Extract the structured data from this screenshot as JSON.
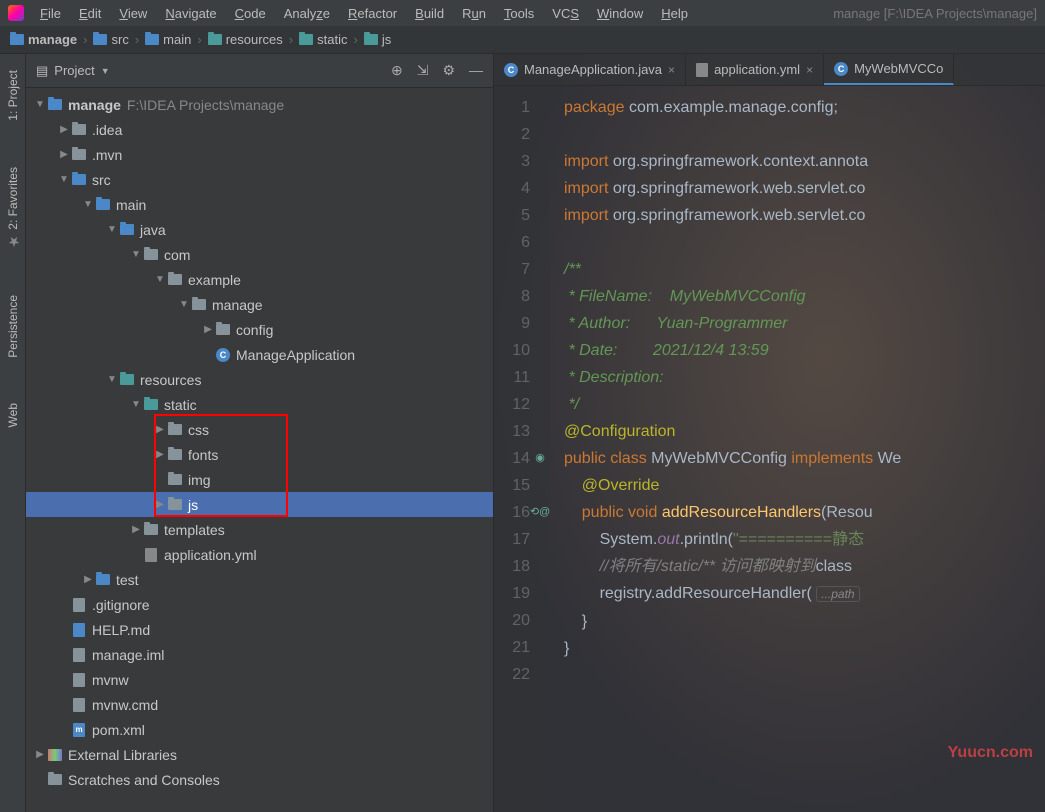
{
  "menubar": {
    "items": [
      "File",
      "Edit",
      "View",
      "Navigate",
      "Code",
      "Analyze",
      "Refactor",
      "Build",
      "Run",
      "Tools",
      "VCS",
      "Window",
      "Help"
    ],
    "title": "manage [F:\\IDEA Projects\\manage]"
  },
  "breadcrumb": [
    {
      "icon": "folder-blue",
      "label": "manage"
    },
    {
      "icon": "folder-blue",
      "label": "src"
    },
    {
      "icon": "folder-blue",
      "label": "main"
    },
    {
      "icon": "folder-teal",
      "label": "resources"
    },
    {
      "icon": "folder-teal",
      "label": "static"
    },
    {
      "icon": "folder-teal",
      "label": "js"
    }
  ],
  "sidebar_tabs": [
    "1: Project",
    "2: Favorites",
    "Persistence",
    "Web"
  ],
  "project_panel": {
    "title": "Project"
  },
  "tree": [
    {
      "d": 0,
      "a": "open",
      "i": "folder-blue",
      "l": "manage",
      "p": "F:\\IDEA Projects\\manage"
    },
    {
      "d": 1,
      "a": "closed",
      "i": "folder",
      "l": ".idea"
    },
    {
      "d": 1,
      "a": "closed",
      "i": "folder",
      "l": ".mvn"
    },
    {
      "d": 1,
      "a": "open",
      "i": "folder-blue",
      "l": "src"
    },
    {
      "d": 2,
      "a": "open",
      "i": "folder-blue",
      "l": "main"
    },
    {
      "d": 3,
      "a": "open",
      "i": "folder-blue",
      "l": "java"
    },
    {
      "d": 4,
      "a": "open",
      "i": "folder",
      "l": "com"
    },
    {
      "d": 5,
      "a": "open",
      "i": "folder",
      "l": "example"
    },
    {
      "d": 6,
      "a": "open",
      "i": "folder",
      "l": "manage"
    },
    {
      "d": 7,
      "a": "closed",
      "i": "folder",
      "l": "config"
    },
    {
      "d": 7,
      "a": "none",
      "i": "class",
      "l": "ManageApplication"
    },
    {
      "d": 3,
      "a": "open",
      "i": "folder-teal",
      "l": "resources"
    },
    {
      "d": 4,
      "a": "open",
      "i": "folder-teal",
      "l": "static"
    },
    {
      "d": 5,
      "a": "closed",
      "i": "folder",
      "l": "css"
    },
    {
      "d": 5,
      "a": "closed",
      "i": "folder",
      "l": "fonts"
    },
    {
      "d": 5,
      "a": "none",
      "i": "folder",
      "l": "img"
    },
    {
      "d": 5,
      "a": "closed",
      "i": "folder",
      "l": "js",
      "sel": true
    },
    {
      "d": 4,
      "a": "closed",
      "i": "folder",
      "l": "templates"
    },
    {
      "d": 4,
      "a": "none",
      "i": "yml",
      "l": "application.yml"
    },
    {
      "d": 2,
      "a": "closed",
      "i": "folder-blue",
      "l": "test"
    },
    {
      "d": 1,
      "a": "none",
      "i": "file",
      "l": ".gitignore"
    },
    {
      "d": 1,
      "a": "none",
      "i": "md",
      "l": "HELP.md"
    },
    {
      "d": 1,
      "a": "none",
      "i": "file",
      "l": "manage.iml"
    },
    {
      "d": 1,
      "a": "none",
      "i": "file",
      "l": "mvnw"
    },
    {
      "d": 1,
      "a": "none",
      "i": "file",
      "l": "mvnw.cmd"
    },
    {
      "d": 1,
      "a": "none",
      "i": "pom",
      "l": "pom.xml"
    },
    {
      "d": 0,
      "a": "closed",
      "i": "lib",
      "l": "External Libraries"
    },
    {
      "d": 0,
      "a": "none",
      "i": "scratch",
      "l": "Scratches and Consoles"
    }
  ],
  "editor_tabs": [
    {
      "icon": "class",
      "label": "ManageApplication.java",
      "close": true
    },
    {
      "icon": "yml",
      "label": "application.yml",
      "close": true
    },
    {
      "icon": "class",
      "label": "MyWebMVCCo",
      "close": false,
      "active": true
    }
  ],
  "code": {
    "lines": 22,
    "content": {
      "l1": {
        "pre": "package ",
        "pkg": "com.example.manage.config",
        "post": ";"
      },
      "l3": {
        "kw": "import ",
        "pkg": "org.springframework.context.annota"
      },
      "l4": {
        "kw": "import ",
        "pkg": "org.springframework.web.servlet.co"
      },
      "l5": {
        "kw": "import ",
        "pkg": "org.springframework.web.servlet.co"
      },
      "l7": "/**",
      "l8": " * FileName:    MyWebMVCConfig",
      "l9": " * Author:      Yuan-Programmer",
      "l10": " * Date:        2021/12/4 13:59",
      "l11": " * Description:",
      "l12": " */",
      "l13": "@Configuration",
      "l14": {
        "k1": "public ",
        "k2": "class ",
        "t": "MyWebMVCConfig ",
        "k3": "implements ",
        "t2": "We"
      },
      "l15": "@Override",
      "l16": {
        "k1": "public ",
        "k2": "void ",
        "fn": "addResourceHandlers",
        "p": "(Resou"
      },
      "l17": {
        "p1": "System.",
        "f": "out",
        "p2": ".println(",
        "s": "\"==========静态"
      },
      "l18": {
        "c": "//将所有/static/** 访问都映射到",
        "t": "class"
      },
      "l19": {
        "p1": "registry.addResourceHandler( ",
        "fold": "...path"
      },
      "l20": "}",
      "l21": "}"
    }
  },
  "watermark": "Yuucn.com"
}
